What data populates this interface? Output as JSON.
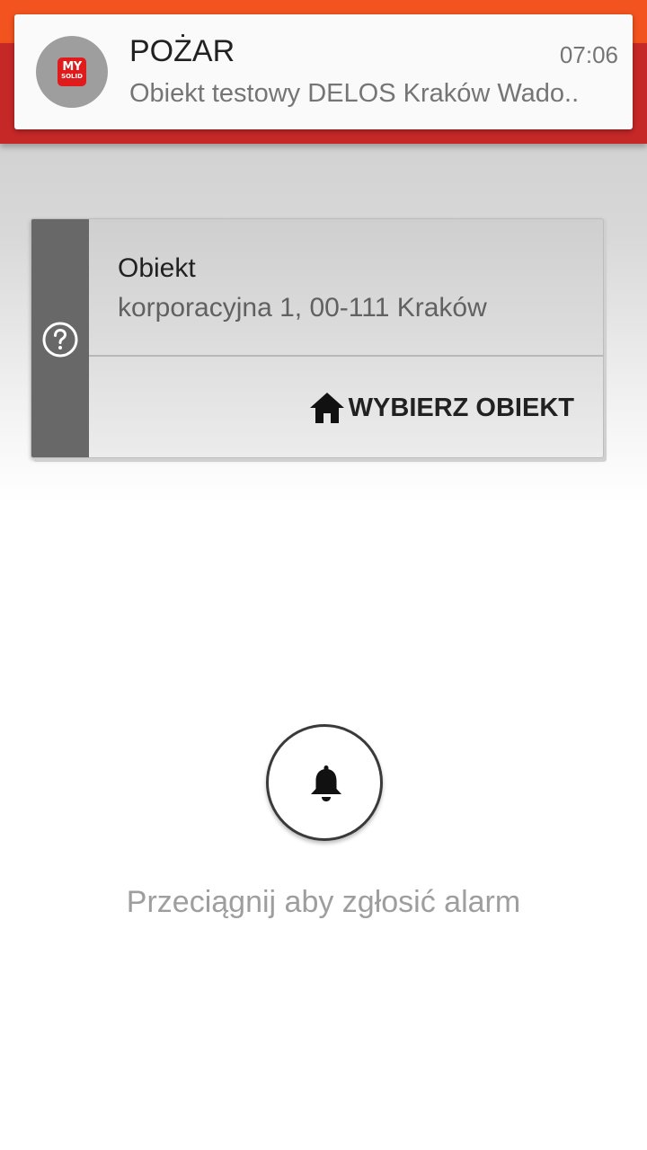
{
  "notification": {
    "title": "POŻAR",
    "time": "07:06",
    "text": "Obiekt testowy DELOS Kraków Wado..",
    "app_logo": {
      "line1": "MY",
      "line2": "SOLID",
      "color": "#e01b1b"
    }
  },
  "object_card": {
    "status_icon": "question-circle-icon",
    "title": "Obiekt",
    "address": "korporacyjna 1, 00-111 Kraków",
    "action_icon": "home-icon",
    "action_label": "WYBIERZ OBIEKT"
  },
  "alarm": {
    "icon": "bell-icon",
    "hint": "Przeciągnij aby zgłosić alarm"
  },
  "colors": {
    "header_orange": "#f2531f",
    "header_red": "#c62828",
    "card_side": "#686868"
  }
}
